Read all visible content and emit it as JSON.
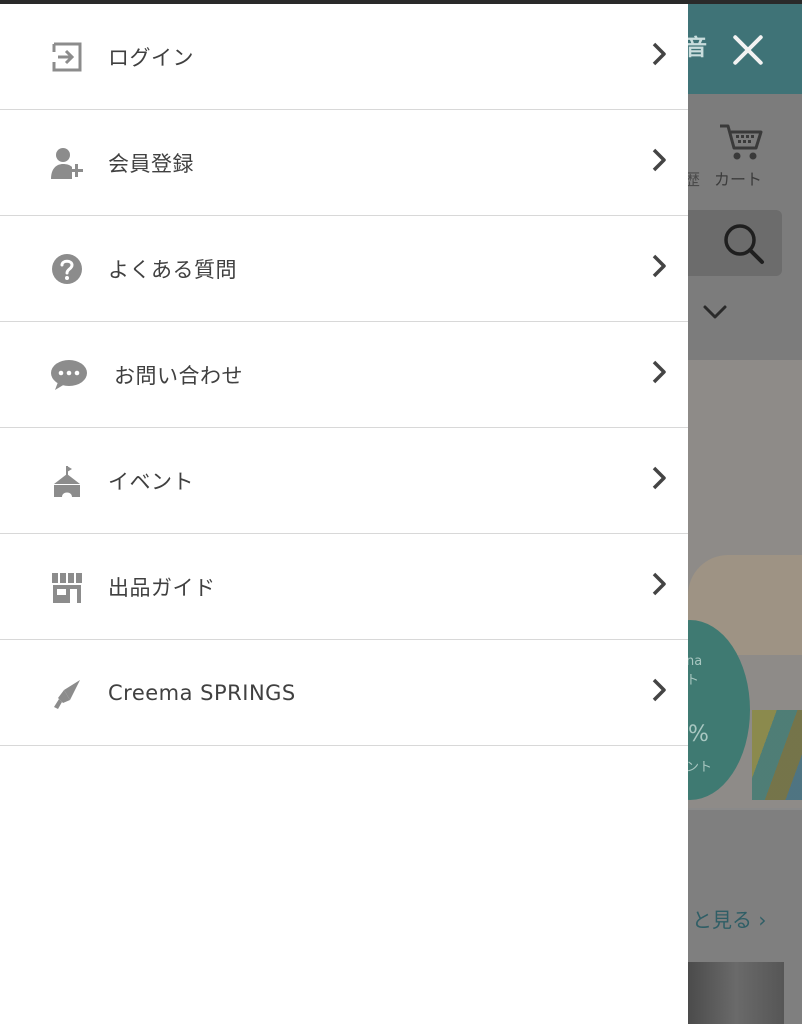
{
  "menu": {
    "items": [
      {
        "label": "ログイン",
        "icon": "login-icon"
      },
      {
        "label": "会員登録",
        "icon": "add-user-icon"
      },
      {
        "label": "よくある質問",
        "icon": "question-icon"
      },
      {
        "label": "お問い合わせ",
        "icon": "chat-icon"
      },
      {
        "label": "イベント",
        "icon": "tent-icon"
      },
      {
        "label": "出品ガイド",
        "icon": "shop-icon"
      },
      {
        "label": "Creema SPRINGS",
        "icon": "megaphone-icon"
      }
    ]
  },
  "background": {
    "header_fragment": "音",
    "history_fragment": "歴",
    "cart_label": "カート",
    "promo_top": "na",
    "promo_top2": "ト",
    "promo_percent": "%",
    "promo_bottom": "ント",
    "more_link": "と見る ›"
  },
  "colors": {
    "header_teal": "#3f7377",
    "icon_gray": "#8c8c8c",
    "text": "#404040",
    "divider": "#d8d8d8"
  }
}
